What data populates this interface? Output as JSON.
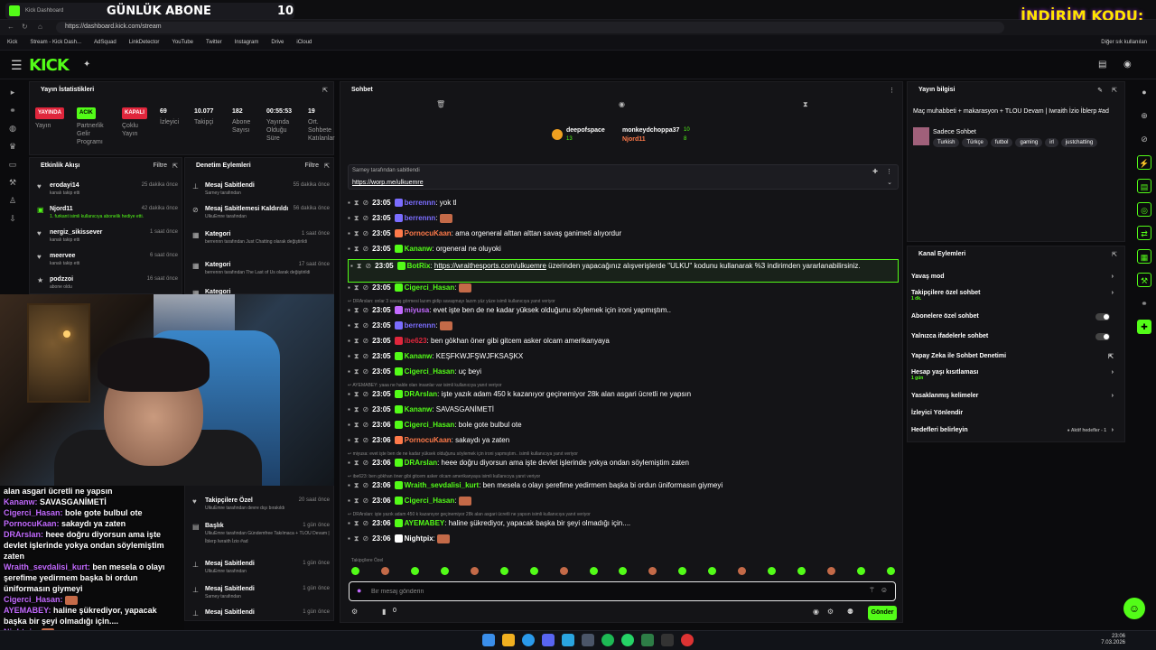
{
  "browser": {
    "tab_title": "Kick Dashboard",
    "overlay_title": "GÜNLÜK ABONE",
    "overlay_count": "10",
    "promo": "İNDİRİM KODU:",
    "url": "https://dashboard.kick.com/stream",
    "bookmarks": [
      "Kick",
      "Stream - Kick Dash...",
      "AdSquad",
      "LinkDetector",
      "YouTube",
      "Twitter",
      "Instagram",
      "Drive",
      "iCloud"
    ],
    "bookmarks_right": "Diğer sık kullanılan"
  },
  "header": {
    "logo": "KICK"
  },
  "stats": {
    "title": "Yayın İstatistikleri",
    "items": [
      {
        "badge": "YAYINDA",
        "badge_color": "#e0263c",
        "label": "Yayın"
      },
      {
        "badge": "ACIK",
        "badge_color": "#53fc18",
        "label": "Partnerlik Gelir Programı"
      },
      {
        "badge": "KAPALI",
        "badge_color": "#e0263c",
        "label": "Çoklu Yayın"
      },
      {
        "value": "69",
        "label": "İzleyici"
      },
      {
        "value": "10.077",
        "label": "Takipçi"
      },
      {
        "value": "182",
        "label": "Abone Sayısı"
      },
      {
        "value": "00:55:53",
        "label": "Yayında Olduğu Süre"
      },
      {
        "value": "19",
        "label": "Ort. Sohbete Katılanlar"
      }
    ]
  },
  "activity": {
    "title": "Etkinlik Akışı",
    "filter": "Filtre",
    "items": [
      {
        "name": "erodayi14",
        "sub": "kanalı takip etti",
        "time": "25 dakika önce",
        "icon": "heart"
      },
      {
        "name": "Njord11",
        "sub": "1. furkant isimli kullanıcıya abonelik hediye etti.",
        "time": "42 dakika önce",
        "icon": "gift"
      },
      {
        "name": "nergiz_sikissever",
        "sub": "kanalı takip etti",
        "time": "1 saat önce",
        "icon": "heart"
      },
      {
        "name": "meervee",
        "sub": "kanalı takip etti",
        "time": "6 saat önce",
        "icon": "heart"
      },
      {
        "name": "podzzoi",
        "sub": "abone oldu",
        "time": "16 saat önce",
        "icon": "star"
      }
    ]
  },
  "moderation": {
    "title": "Denetim Eylemleri",
    "filter": "Filtre",
    "items": [
      {
        "name": "Mesaj Sabitlendi",
        "sub": "Sarney tarafından",
        "time": "55 dakika önce"
      },
      {
        "name": "Mesaj Sabitlemesi Kaldırıldı",
        "sub": "UlkuEmre tarafından",
        "time": "56 dakika önce"
      },
      {
        "name": "Kategori",
        "sub": "berrennn tarafından Just Chatting olarak değiştirildi",
        "time": "1 saat önce"
      },
      {
        "name": "Kategori",
        "sub": "berrennn tarafından The Last of Us olarak değiştirildi",
        "time": "17 saat önce"
      },
      {
        "name": "Kategori",
        "sub": "",
        "time": ""
      }
    ],
    "lower": [
      {
        "name": "Takipçilere Özel",
        "sub": "UlkuEmre tarafından devre dışı bırakıldı",
        "time": "20 saat önce"
      },
      {
        "name": "Başlık",
        "sub": "UlkuEmre tarafından Gündemfree Takılmaca + TLOU Devam | İblerp Iwraith İzio #ad",
        "time": "1 gün önce"
      },
      {
        "name": "Mesaj Sabitlendi",
        "sub": "UlkuEmre tarafından",
        "time": "1 gün önce"
      },
      {
        "name": "Mesaj Sabitlendi",
        "sub": "Sarney tarafından",
        "time": "1 gün önce"
      },
      {
        "name": "Mesaj Sabitlendi",
        "sub": "",
        "time": "1 gün önce"
      }
    ]
  },
  "overlay_chat": [
    {
      "name": "",
      "text": "alan asgari ücretli ne yapsın"
    },
    {
      "name": "Kananw:",
      "text": "SAVASGANİMETİ"
    },
    {
      "name": "Cigerci_Hasan:",
      "text": "bole gote bulbul ote"
    },
    {
      "name": "PornocuKaan:",
      "text": "sakaydı ya zaten"
    },
    {
      "name": "DRArslan:",
      "text": "heee doğru diyorsun ama işte devlet işlerinde yokya ondan söylemiştim zaten"
    },
    {
      "name": "Wraith_sevdalisi_kurt:",
      "text": "ben mesela o olayı şerefime yedirmem başka bi ordun üniformasın giymeyi"
    },
    {
      "name": "Cigerci_Hasan:",
      "text": ""
    },
    {
      "name": "AYEMABEY:",
      "text": "haline şükrediyor, yapacak başka bir şeyi olmadığı için...."
    },
    {
      "name": "Nightpix:",
      "text": ""
    }
  ],
  "chat": {
    "title": "Sohbet",
    "top_subs": [
      {
        "name": "deepofspace",
        "count": "13"
      },
      {
        "name": "monkeydchoppa37",
        "count": "10"
      },
      {
        "name": "Njord11",
        "count": "8"
      }
    ],
    "pinned_by": "Sarney tarafından sabitlendi",
    "pinned_link": "https://worp.me/ulkuemre",
    "messages": [
      {
        "type": "msg",
        "time": "23:05",
        "user": "berrennn",
        "color": "#7b6dff",
        "text": "yok tl"
      },
      {
        "type": "msg",
        "time": "23:05",
        "user": "berrennn",
        "color": "#7b6dff",
        "text": "",
        "emote": true
      },
      {
        "type": "msg",
        "time": "23:05",
        "user": "PornocuKaan",
        "color": "#ff7a4a",
        "text": "ama orgeneral alttan alttan savaş ganimeti alıyordur"
      },
      {
        "type": "msg",
        "time": "23:05",
        "user": "Kananw",
        "color": "#53fc18",
        "text": "orgeneral ne oluyoki"
      },
      {
        "type": "hl",
        "time": "23:05",
        "user": "BotRix",
        "color": "#53fc18",
        "link": "https://wraithesports.com/ulkuemre",
        "text": "üzerinden yapacağınız alışverişlerde \"ULKU\" kodunu kullanarak %3 indirimden yararlanabilirsiniz."
      },
      {
        "type": "msg",
        "time": "23:05",
        "user": "Cigerci_Hasan",
        "color": "#53fc18",
        "text": "",
        "emote": true
      },
      {
        "type": "reply",
        "text": "DRArslan: onlar 3 savaş görmesi lazım gidip savaşmayı lazım yüz yüze isimli kullanıcıya yanıt veriyor"
      },
      {
        "type": "msg",
        "time": "23:05",
        "user": "miyusa",
        "color": "#c36aff",
        "text": "evet işte ben de ne kadar yüksek olduğunu söylemek için ironi yapmıştım.."
      },
      {
        "type": "msg",
        "time": "23:05",
        "user": "berrennn",
        "color": "#7b6dff",
        "text": "",
        "emote": true
      },
      {
        "type": "msg",
        "time": "23:05",
        "user": "ibe623",
        "color": "#e0263c",
        "text": "ben gökhan öner gibi gitcem asker olcam amerikanyaya"
      },
      {
        "type": "msg",
        "time": "23:05",
        "user": "Kananw",
        "color": "#53fc18",
        "text": "KEŞFKWJFŞWJFKSAŞKX"
      },
      {
        "type": "msg",
        "time": "23:05",
        "user": "Cigerci_Hasan",
        "color": "#53fc18",
        "text": "uç beyi"
      },
      {
        "type": "reply",
        "text": "AYEMABEY: yaaa ne halde olan insanlar var isimli kullanıcıya yanıt veriyor"
      },
      {
        "type": "msg",
        "time": "23:05",
        "user": "DRArslan",
        "color": "#53fc18",
        "text": "işte yazık adam 450 k kazanıyor geçinemiyor 28k alan asgari ücretli ne yapsın"
      },
      {
        "type": "msg",
        "time": "23:05",
        "user": "Kananw",
        "color": "#53fc18",
        "text": "SAVASGANİMETİ"
      },
      {
        "type": "msg",
        "time": "23:06",
        "user": "Cigerci_Hasan",
        "color": "#53fc18",
        "text": "bole gote bulbul ote"
      },
      {
        "type": "msg",
        "time": "23:06",
        "user": "PornocuKaan",
        "color": "#ff7a4a",
        "text": "sakaydı ya zaten"
      },
      {
        "type": "reply",
        "text": "miyusa: evet işte ben de ne kadar yüksek olduğunu söylemek için ironi yapmıştım.. isimli kullanıcıya yanıt veriyor"
      },
      {
        "type": "msg",
        "time": "23:06",
        "user": "DRArslan",
        "color": "#53fc18",
        "text": "heee doğru diyorsun ama işte devlet işlerinde yokya ondan söylemiştim zaten"
      },
      {
        "type": "reply",
        "text": "ibe623: ben gökhan öner gibi gitcem asker olcam amerikanyaya isimli kullanıcıya yanıt veriyor"
      },
      {
        "type": "msg",
        "time": "23:06",
        "user": "Wraith_sevdalisi_kurt",
        "color": "#53fc18",
        "text": "ben mesela o olayı şerefime yedirmem başka bi ordun üniformasın giymeyi"
      },
      {
        "type": "msg",
        "time": "23:06",
        "user": "Cigerci_Hasan",
        "color": "#53fc18",
        "text": "",
        "emote": true
      },
      {
        "type": "reply",
        "text": "DRArslan: işte yazık adam 450 k kazanıyor geçinemiyor 28k alan asgari ücretli ne yapsın isimli kullanıcıya yanıt veriyor"
      },
      {
        "type": "msg",
        "time": "23:06",
        "user": "AYEMABEY",
        "color": "#53fc18",
        "text": "haline şükrediyor, yapacak başka bir şeyi olmadığı için...."
      },
      {
        "type": "msg",
        "time": "23:06",
        "user": "Nightpix",
        "color": "#fff",
        "text": "",
        "emote": true
      }
    ],
    "followers_only": "Takipçilere Özel",
    "input_placeholder": "Bir mesaj gönderin",
    "points": "0",
    "send_label": "Gönder"
  },
  "stream_info": {
    "title": "Yayın bilgisi",
    "stream_title": "Maç muhabbeti + makarasyon + TLOU Devam | Iwraith İzio İblerp #ad",
    "category": "Sadece Sohbet",
    "tags": [
      "Turkish",
      "Türkçe",
      "futbol",
      "gaming",
      "irl",
      "justchatting"
    ]
  },
  "chat_modes": {
    "title": "Kanal Eylemleri",
    "items": [
      {
        "label": "Yavaş mod",
        "sub": "",
        "control": "arrow"
      },
      {
        "label": "Takipçilere özel sohbet",
        "sub": "1 dk.",
        "control": "arrow"
      },
      {
        "label": "Abonelere özel sohbet",
        "sub": "",
        "control": "toggle"
      },
      {
        "label": "Yalnızca ifadelerle sohbet",
        "sub": "",
        "control": "toggle"
      },
      {
        "label": "Yapay Zeka ile Sohbet Denetimi",
        "sub": "",
        "control": "link"
      },
      {
        "label": "Hesap yaşı kısıtlaması",
        "sub": "1 gün",
        "control": "arrow"
      },
      {
        "label": "Yasaklanmış kelimeler",
        "sub": "",
        "control": "arrow"
      },
      {
        "label": "İzleyici Yönlendir",
        "sub": "",
        "control": "none"
      },
      {
        "label": "Hedefleri belirleyin",
        "sub": "",
        "control": "arrow"
      }
    ],
    "goals_status": "Aktif hedefler - 1"
  },
  "taskbar": {
    "time": "23:06",
    "date": "7.03.2026"
  }
}
